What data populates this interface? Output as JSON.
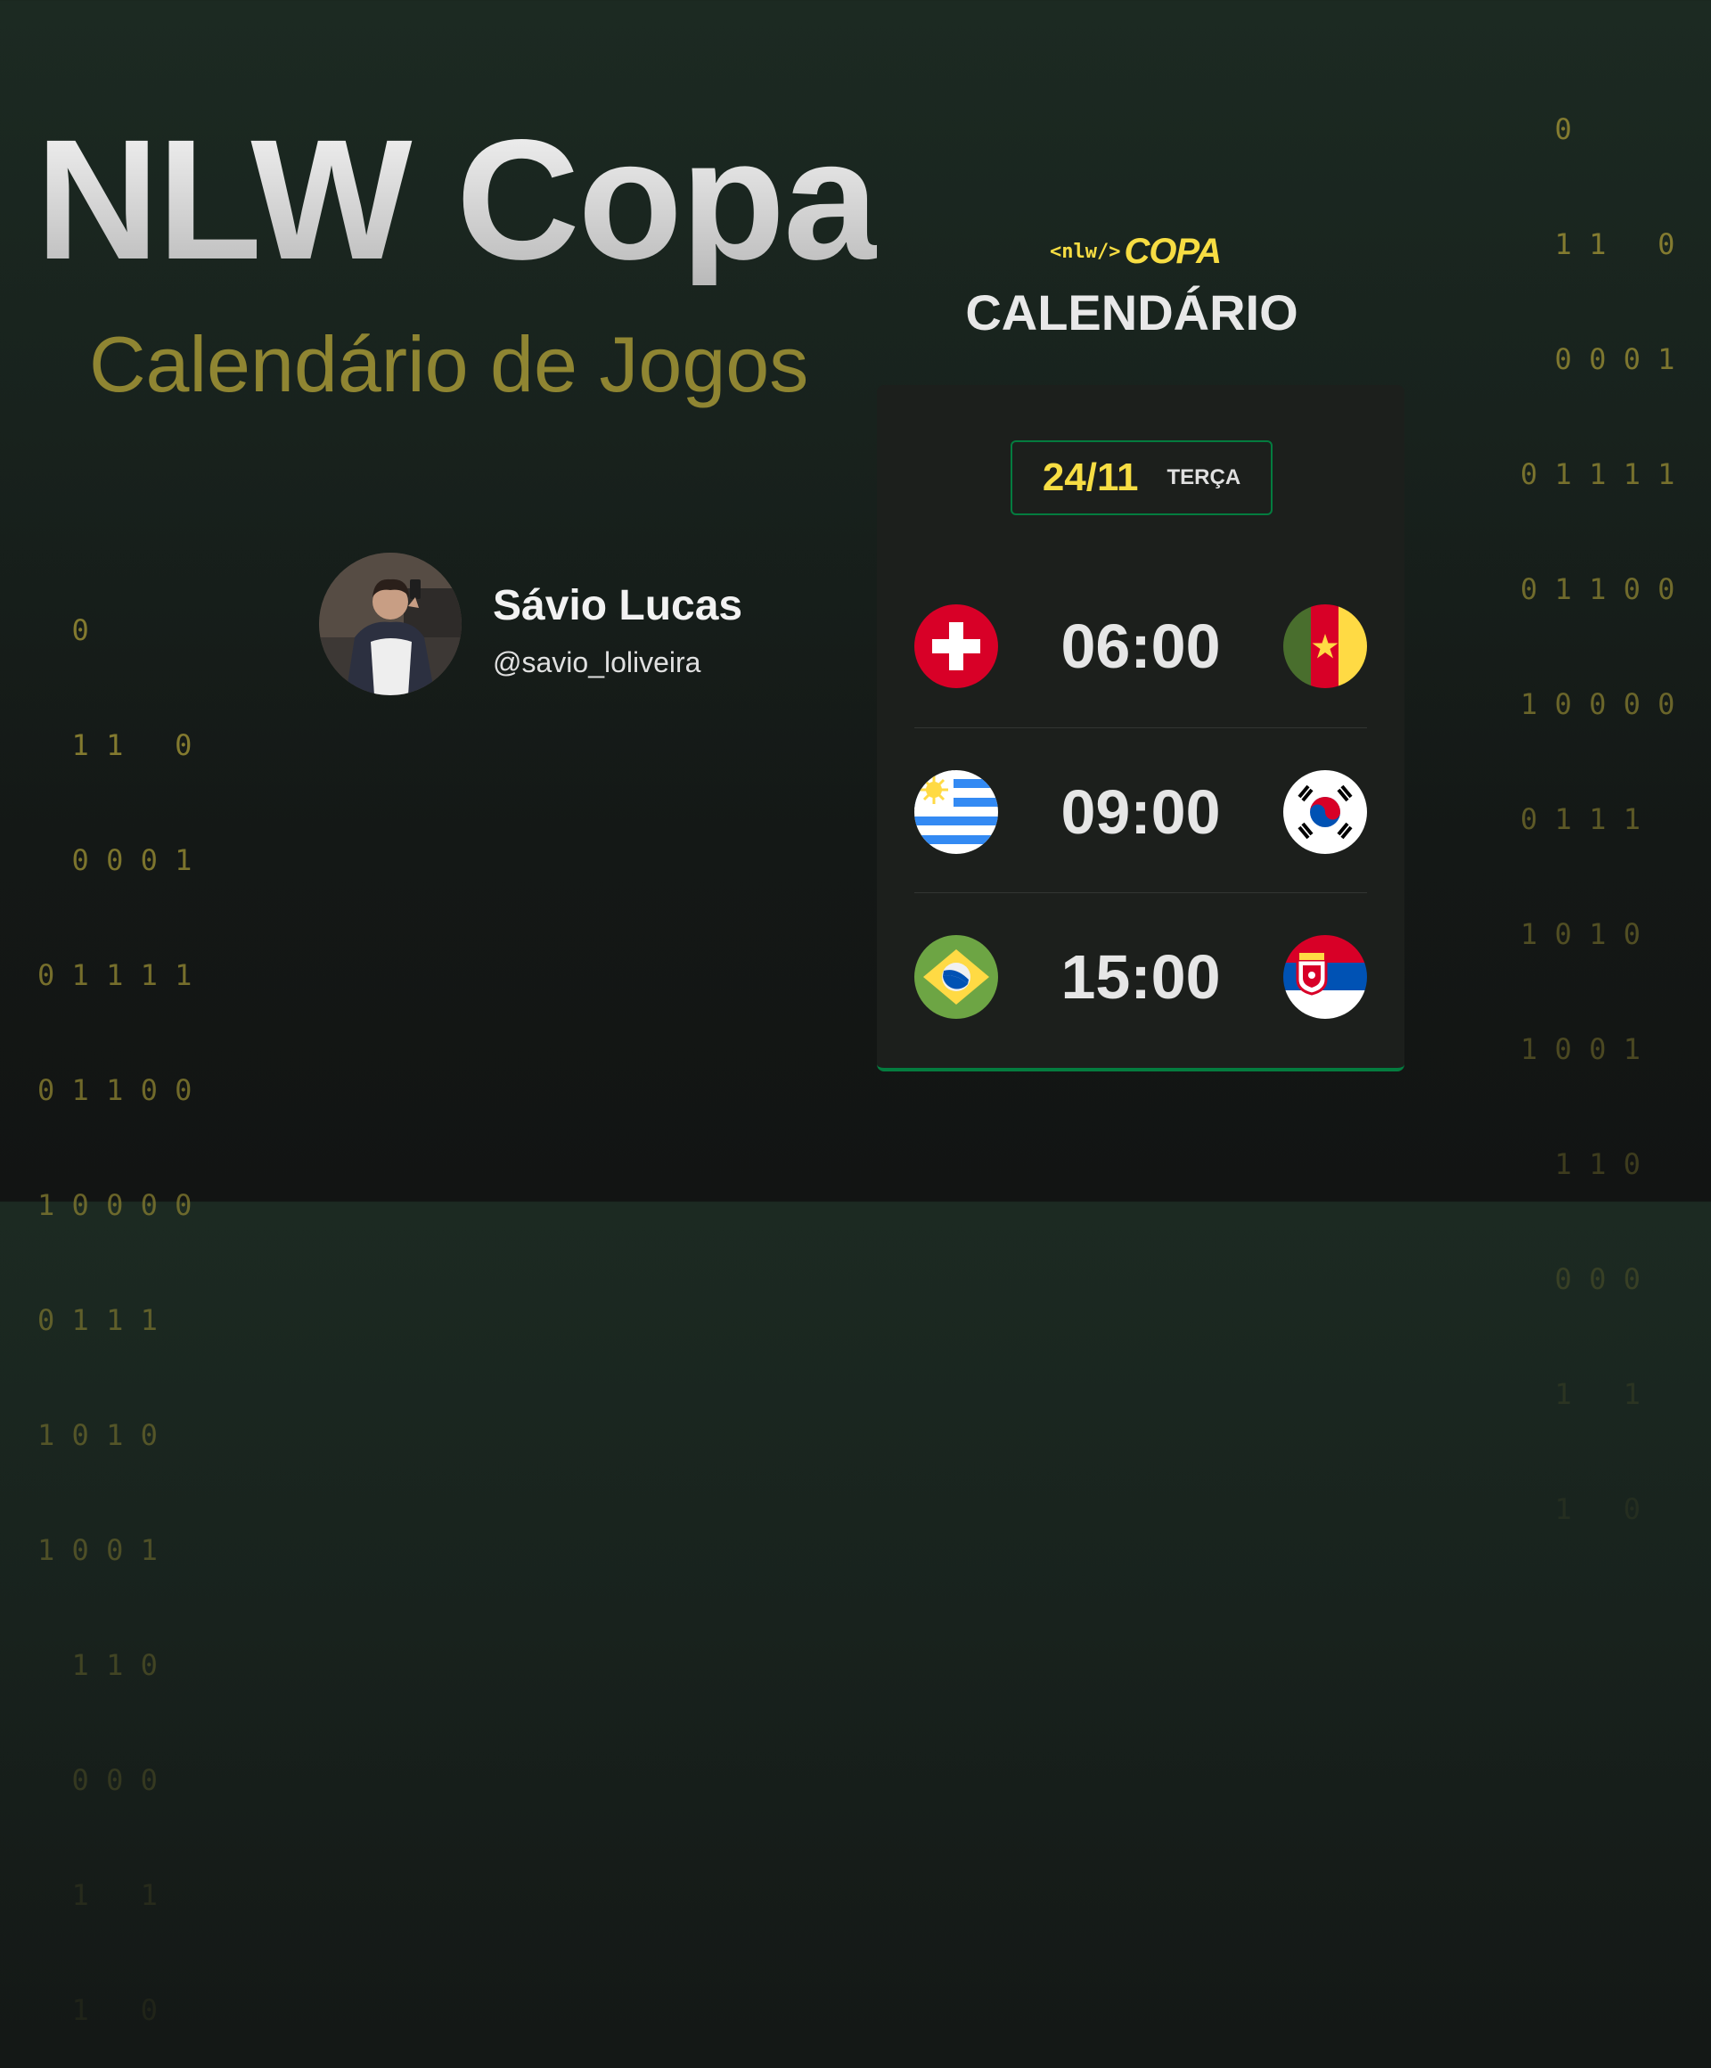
{
  "hero": {
    "title": "NLW Copa",
    "subtitle": "Calendário de Jogos"
  },
  "author": {
    "name": "Sávio Lucas",
    "handle": "@savio_loliveira",
    "avatar_icon": "person-photo"
  },
  "brand": {
    "logo_tag": "<nlw/>",
    "logo_text": "COPA",
    "section_title": "CALENDÁRIO"
  },
  "schedule": {
    "date": "24/11",
    "weekday": "TERÇA",
    "matches": [
      {
        "time": "06:00",
        "home_flag": "switzerland-flag-icon",
        "away_flag": "cameroon-flag-icon"
      },
      {
        "time": "09:00",
        "home_flag": "uruguay-flag-icon",
        "away_flag": "south-korea-flag-icon"
      },
      {
        "time": "15:00",
        "home_flag": "brazil-flag-icon",
        "away_flag": "serbia-flag-icon"
      }
    ]
  },
  "decor": {
    "binary_lines": [
      "0",
      "11 0",
      "0001",
      "01111",
      "01100",
      "10000",
      "0111",
      "1010",
      "1001",
      "110",
      "000",
      "1 1",
      "1 0"
    ]
  },
  "colors": {
    "accent_yellow": "#f7dd43",
    "accent_green": "#047c3f",
    "subtitle_olive": "#8f8532",
    "card_bg": "#1c1f1c"
  }
}
